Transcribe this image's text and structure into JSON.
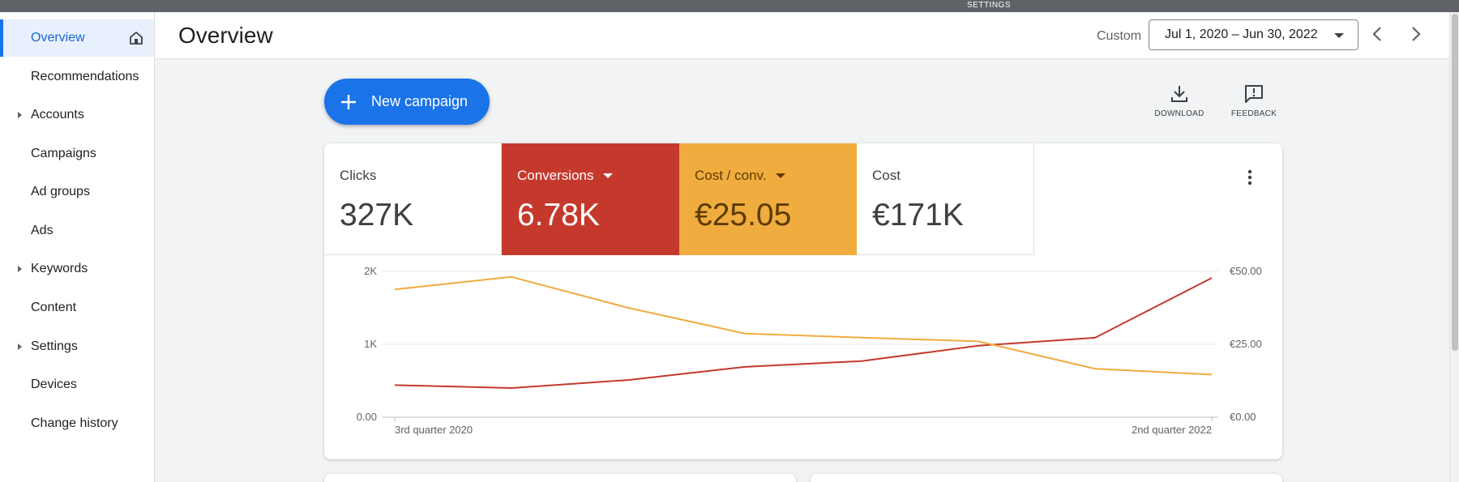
{
  "top_strip": {
    "label": "SETTINGS"
  },
  "sidebar": {
    "items": [
      {
        "label": "Overview",
        "active": true,
        "expandable": false
      },
      {
        "label": "Recommendations",
        "active": false,
        "expandable": false
      },
      {
        "label": "Accounts",
        "active": false,
        "expandable": true
      },
      {
        "label": "Campaigns",
        "active": false,
        "expandable": false
      },
      {
        "label": "Ad groups",
        "active": false,
        "expandable": false
      },
      {
        "label": "Ads",
        "active": false,
        "expandable": false
      },
      {
        "label": "Keywords",
        "active": false,
        "expandable": true
      },
      {
        "label": "Content",
        "active": false,
        "expandable": false
      },
      {
        "label": "Settings",
        "active": false,
        "expandable": true
      },
      {
        "label": "Devices",
        "active": false,
        "expandable": false
      },
      {
        "label": "Change history",
        "active": false,
        "expandable": false
      }
    ]
  },
  "header": {
    "title": "Overview",
    "date_mode": "Custom",
    "date_range": "Jul 1, 2020 – Jun 30, 2022"
  },
  "actions": {
    "new_campaign": "New campaign",
    "download": "DOWNLOAD",
    "feedback": "FEEDBACK"
  },
  "metrics": [
    {
      "label": "Clicks",
      "value": "327K"
    },
    {
      "label": "Conversions",
      "value": "6.78K",
      "color": "#c5392d"
    },
    {
      "label": "Cost / conv.",
      "value": "€25.05",
      "color": "#f0ac3e"
    },
    {
      "label": "Cost",
      "value": "€171K"
    }
  ],
  "chart_data": {
    "type": "line",
    "x_labels": [
      "3rd quarter 2020",
      "",
      "",
      "",
      "",
      "",
      "",
      "2nd quarter 2022"
    ],
    "y_left_ticks": [
      "0.00",
      "1K",
      "2K"
    ],
    "y_left_lim": [
      0,
      2000
    ],
    "y_right_ticks": [
      "€0.00",
      "€25.00",
      "€50.00"
    ],
    "y_right_lim": [
      0,
      50
    ],
    "series": [
      {
        "name": "Conversions",
        "axis": "left",
        "color": "#c5392d",
        "values": [
          440,
          400,
          510,
          690,
          770,
          980,
          1090,
          1910
        ]
      },
      {
        "name": "Cost / conv.",
        "axis": "right",
        "color": "#f0ac3e",
        "values": [
          43.8,
          48.1,
          37.5,
          28.7,
          27.3,
          26.0,
          16.6,
          14.6
        ]
      }
    ],
    "grid": true
  }
}
